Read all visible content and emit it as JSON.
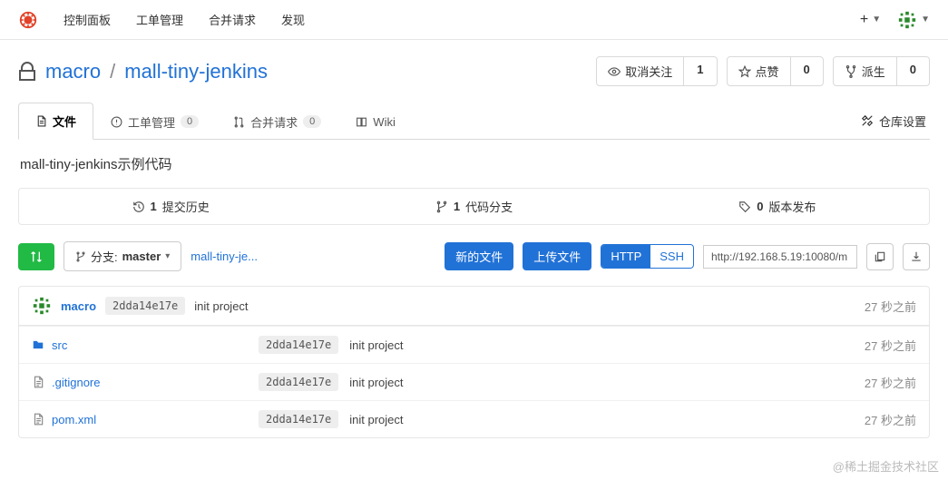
{
  "topnav": {
    "items": [
      "控制面板",
      "工单管理",
      "合并请求",
      "发现"
    ]
  },
  "repo": {
    "owner": "macro",
    "name": "mall-tiny-jenkins",
    "description": "mall-tiny-jenkins示例代码"
  },
  "repo_actions": {
    "unwatch": {
      "label": "取消关注",
      "count": "1"
    },
    "star": {
      "label": "点赞",
      "count": "0"
    },
    "fork": {
      "label": "派生",
      "count": "0"
    }
  },
  "tabs": {
    "files": {
      "label": "文件"
    },
    "issues": {
      "label": "工单管理",
      "count": "0"
    },
    "pulls": {
      "label": "合并请求",
      "count": "0"
    },
    "wiki": {
      "label": "Wiki"
    },
    "settings": {
      "label": "仓库设置"
    }
  },
  "stats": {
    "commits": {
      "count": "1",
      "label": "提交历史"
    },
    "branches": {
      "count": "1",
      "label": "代码分支"
    },
    "releases": {
      "count": "0",
      "label": "版本发布"
    }
  },
  "toolbar": {
    "branch_prefix": "分支:",
    "branch_name": "master",
    "breadcrumb": "mall-tiny-je...",
    "new_file": "新的文件",
    "upload": "上传文件",
    "http": "HTTP",
    "ssh": "SSH",
    "clone_url": "http://192.168.5.19:10080/m"
  },
  "last_commit": {
    "author": "macro",
    "sha": "2dda14e17e",
    "message": "init project",
    "time": "27 秒之前"
  },
  "files": [
    {
      "type": "folder",
      "name": "src",
      "sha": "2dda14e17e",
      "msg": "init project",
      "time": "27 秒之前"
    },
    {
      "type": "file",
      "name": ".gitignore",
      "sha": "2dda14e17e",
      "msg": "init project",
      "time": "27 秒之前"
    },
    {
      "type": "file",
      "name": "pom.xml",
      "sha": "2dda14e17e",
      "msg": "init project",
      "time": "27 秒之前"
    }
  ],
  "watermark": "@稀土掘金技术社区"
}
